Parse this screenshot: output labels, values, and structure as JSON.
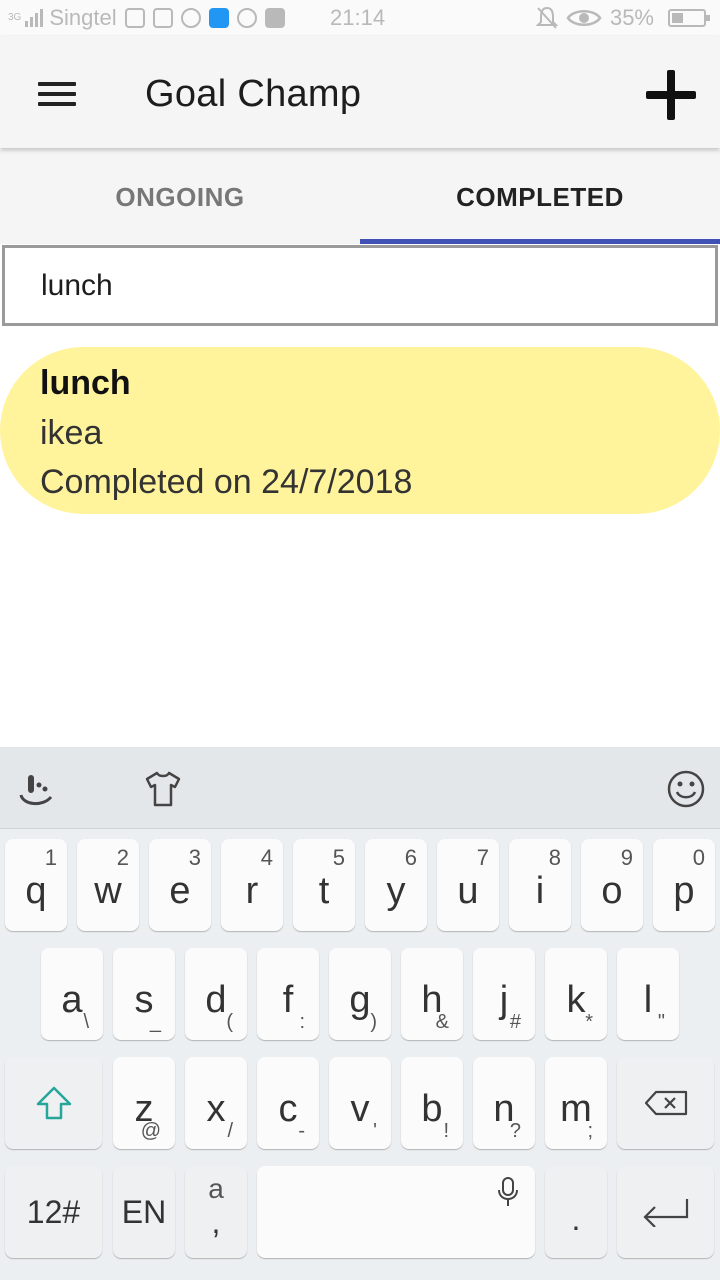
{
  "status_bar": {
    "signal_type": "3G",
    "carrier": "Singtel",
    "time": "21:14",
    "battery": "35%",
    "battery_level": 0.35,
    "icons": [
      "gmail-icon",
      "instagram-icon",
      "shield-icon",
      "message-icon",
      "messenger-icon",
      "facebook-icon",
      "mute-icon",
      "eye-icon",
      "battery-icon"
    ]
  },
  "app_bar": {
    "title": "Goal Champ",
    "menu_icon": "hamburger-menu-icon",
    "add_icon": "plus-icon"
  },
  "tabs": [
    {
      "label": "ONGOING",
      "selected": false
    },
    {
      "label": "COMPLETED",
      "selected": true
    }
  ],
  "colors": {
    "tab_indicator": "#3f51b5",
    "card_background": "#fff39b"
  },
  "search": {
    "value": "lunch"
  },
  "goals": [
    {
      "title": "lunch",
      "place": "ikea",
      "completed": "Completed on 24/7/2018"
    }
  ],
  "keyboard": {
    "toolbar_icons": [
      "touchpal-icon",
      "tshirt-theme-icon",
      "emoji-icon"
    ],
    "row1": [
      {
        "key": "q",
        "sup": "1"
      },
      {
        "key": "w",
        "sup": "2"
      },
      {
        "key": "e",
        "sup": "3"
      },
      {
        "key": "r",
        "sup": "4"
      },
      {
        "key": "t",
        "sup": "5"
      },
      {
        "key": "y",
        "sup": "6"
      },
      {
        "key": "u",
        "sup": "7"
      },
      {
        "key": "i",
        "sup": "8"
      },
      {
        "key": "o",
        "sup": "9"
      },
      {
        "key": "p",
        "sup": "0"
      }
    ],
    "row2": [
      {
        "key": "a",
        "sub": "\\"
      },
      {
        "key": "s",
        "sub": "_"
      },
      {
        "key": "d",
        "sub": "("
      },
      {
        "key": "f",
        "sub": ":"
      },
      {
        "key": "g",
        "sub": ")"
      },
      {
        "key": "h",
        "sub": "&"
      },
      {
        "key": "j",
        "sub": "#"
      },
      {
        "key": "k",
        "sub": "*"
      },
      {
        "key": "l",
        "sub": "\""
      }
    ],
    "row3": [
      {
        "key": "z",
        "sub": "@"
      },
      {
        "key": "x",
        "sub": "/"
      },
      {
        "key": "c",
        "sub": "-"
      },
      {
        "key": "v",
        "sub": "'"
      },
      {
        "key": "b",
        "sub": "!"
      },
      {
        "key": "n",
        "sub": "?"
      },
      {
        "key": "m",
        "sub": ";"
      }
    ],
    "symbols_key": "12#",
    "language_key": "EN",
    "comma_key_top": "a",
    "comma_key_bottom": ",",
    "period_key": "."
  }
}
